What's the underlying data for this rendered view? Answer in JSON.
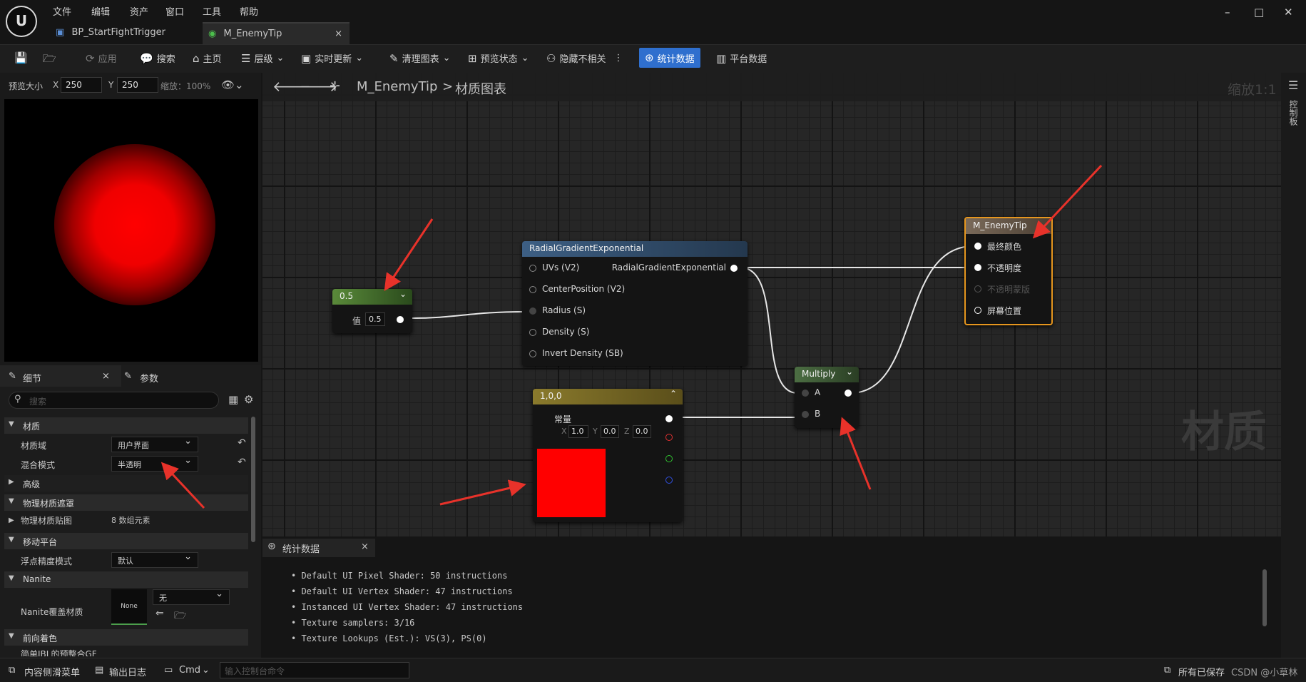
{
  "menu": [
    "文件",
    "编辑",
    "资产",
    "窗口",
    "工具",
    "帮助"
  ],
  "tabs": [
    {
      "label": "BP_StartFightTrigger"
    },
    {
      "label": "M_EnemyTip",
      "close": "×"
    }
  ],
  "window_controls": {
    "minimize": "–",
    "maximize": "□",
    "close": "✕"
  },
  "logo": "U",
  "toolbar": {
    "apply": "应用",
    "search": "搜索",
    "home": "主页",
    "hierarchy": "层级",
    "live_update": "实时更新",
    "clean_graph": "清理图表",
    "preview_state": "预览状态",
    "hide_unrelated": "隐藏不相关",
    "stats": "统计数据",
    "platform_stats": "平台数据"
  },
  "preview": {
    "size_label": "预览大小",
    "x_label": "X",
    "x_value": "250",
    "y_label": "Y",
    "y_value": "250",
    "zoom": "缩放：100%"
  },
  "details": {
    "tab_details": "细节",
    "tab_params": "参数",
    "close": "×",
    "search_placeholder": "搜索",
    "sections": {
      "material": "材质",
      "advanced": "高级",
      "phys_mask": "物理材质遮罩",
      "mobile": "移动平台",
      "nanite": "Nanite",
      "forward": "前向着色"
    },
    "rows": {
      "domain_label": "材质域",
      "domain_value": "用户界面",
      "blend_label": "混合模式",
      "blend_value": "半透明",
      "phys_map_label": "物理材质贴图",
      "phys_map_value": "8 数组元素",
      "float_label": "浮点精度模式",
      "float_value": "默认",
      "nanite_label": "Nanite覆盖材质",
      "nanite_thumb": "None",
      "nanite_value": "无",
      "partial_row": "简单IBL的预整合GF"
    }
  },
  "graph": {
    "breadcrumb_root": "M_EnemyTip",
    "breadcrumb_sep": ">",
    "breadcrumb_page": "材质图表",
    "zoom": "缩放1:1",
    "watermark": "材质",
    "right_panel_label": "控制板"
  },
  "nodes": {
    "scalar": {
      "title": "0.5",
      "pin_label": "值",
      "value": "0.5"
    },
    "radial": {
      "title": "RadialGradientExponential",
      "inputs": [
        "UVs (V2)",
        "CenterPosition (V2)",
        "Radius (S)",
        "Density (S)",
        "Invert Density (SB)"
      ],
      "output": "RadialGradientExponential"
    },
    "constant": {
      "title": "1,0,0",
      "label": "常量",
      "x_label": "X",
      "x": "1.0",
      "y_label": "Y",
      "y": "0.0",
      "z_label": "Z",
      "z": "0.0",
      "swatch": "#ff0000"
    },
    "multiply": {
      "title": "Multiply",
      "a": "A",
      "b": "B"
    },
    "result": {
      "title": "M_EnemyTip",
      "pins": [
        "最终颜色",
        "不透明度",
        "不透明蒙版",
        "屏幕位置"
      ]
    }
  },
  "stats_panel": {
    "tab": "统计数据",
    "close": "×",
    "lines": [
      "Default UI Pixel Shader: 50 instructions",
      "Default UI Vertex Shader: 47 instructions",
      "Instanced UI Vertex Shader: 47 instructions",
      "Texture samplers: 3/16",
      "Texture Lookups (Est.): VS(3), PS(0)"
    ]
  },
  "statusbar": {
    "content_drawer": "内容侧滑菜单",
    "output_log": "输出日志",
    "cmd": "Cmd",
    "console_placeholder": "输入控制台命令",
    "saved": "所有已保存",
    "watermark": "CSDN @小草林"
  },
  "colors": {
    "accent_blue": "#2f6fce",
    "scalar_header": "#5a8a3a",
    "radial_header": "#3d5f84",
    "constant_header": "#8a7a2c",
    "multiply_header": "#4c6e43",
    "result_border": "#e6961e",
    "arrow_red": "#e8322a"
  },
  "icons": {
    "save": "save-icon",
    "browse": "browse-icon",
    "apply": "apply-icon",
    "search": "search-icon",
    "home": "home-icon",
    "hierarchy": "hierarchy-icon",
    "live": "live-update-icon"
  }
}
